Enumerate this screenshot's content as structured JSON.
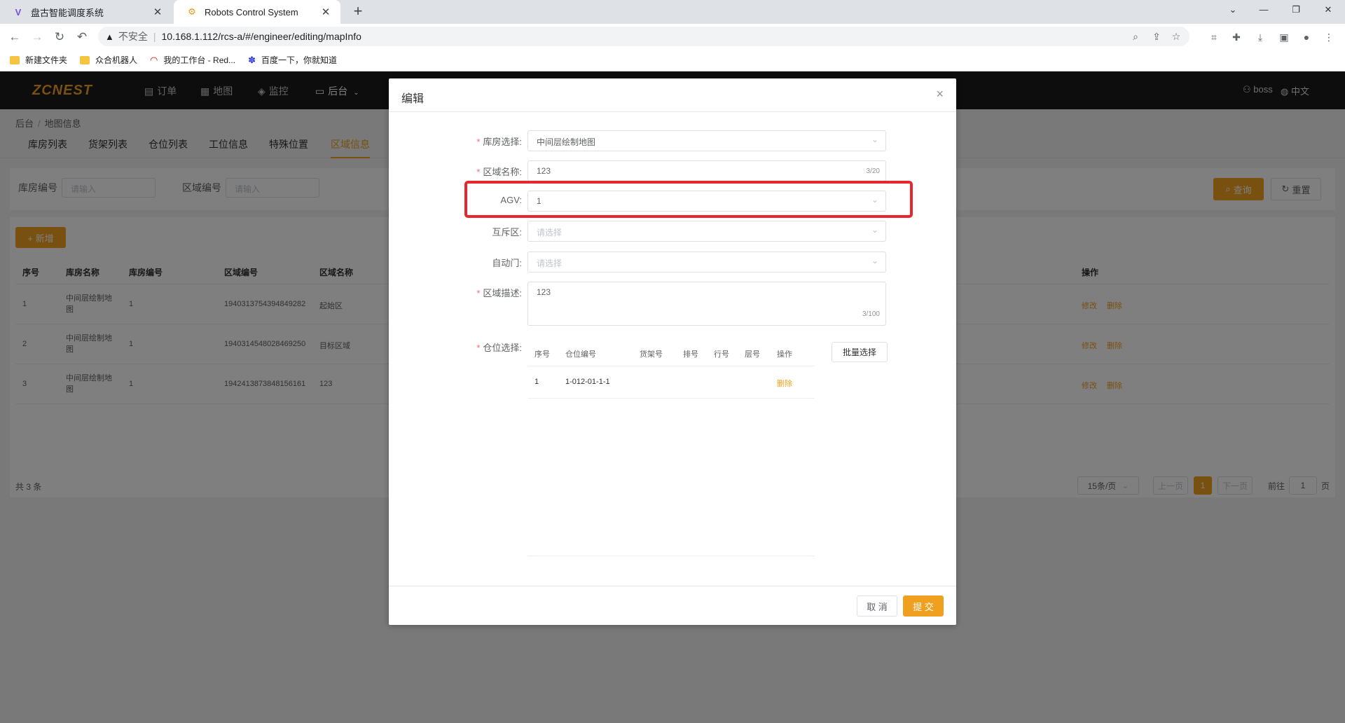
{
  "browser": {
    "tabs": [
      {
        "title": "盘古智能调度系统",
        "close": "✕"
      },
      {
        "title": "Robots Control System",
        "close": "✕"
      }
    ],
    "new_tab": "+",
    "insecure_label": "不安全",
    "url": "10.168.1.112/rcs-a/#/engineer/editing/mapInfo",
    "bookmarks": [
      "新建文件夹",
      "众合机器人",
      "我的工作台 - Red...",
      "百度一下，你就知道"
    ]
  },
  "app": {
    "logo": "ZCNEST",
    "nav": [
      "订单",
      "地图",
      "监控",
      "后台"
    ],
    "user": "boss",
    "lang": "中文",
    "breadcrumb": [
      "后台",
      "地图信息"
    ],
    "subtabs": [
      "库房列表",
      "货架列表",
      "仓位列表",
      "工位信息",
      "特殊位置",
      "区域信息"
    ],
    "active_subtab": "区域信息",
    "filter": {
      "warehouse_label": "库房编号",
      "warehouse_placeholder": "请输入",
      "area_label": "区域编号",
      "area_placeholder": "请输入",
      "search": "查询",
      "reset": "重置"
    },
    "add_button": "+ 新增",
    "table": {
      "headers": [
        "序号",
        "库房名称",
        "库房编号",
        "区域编号",
        "区域名称",
        "操作"
      ],
      "rows": [
        {
          "no": "1",
          "wh_name": "中间层绘制地图",
          "wh_no": "1",
          "area_no": "1940313754394849282",
          "area_name": "起始区"
        },
        {
          "no": "2",
          "wh_name": "中间层绘制地图",
          "wh_no": "1",
          "area_no": "1940314548028469250",
          "area_name": "目标区域"
        },
        {
          "no": "3",
          "wh_name": "中间层绘制地图",
          "wh_no": "1",
          "area_no": "1942413873848156161",
          "area_name": "123"
        }
      ],
      "edit": "修改",
      "delete": "删除"
    },
    "pagination": {
      "total": "共 3 条",
      "page_size": "15条/页",
      "prev": "上一页",
      "current": "1",
      "next": "下一页",
      "goto_label": "前往",
      "goto_value": "1",
      "page_suffix": "页"
    }
  },
  "dialog": {
    "title": "编辑",
    "close": "×",
    "fields": {
      "warehouse": {
        "label": "库房选择:",
        "value": "中间层绘制地图"
      },
      "area_name": {
        "label": "区域名称:",
        "value": "123",
        "count": "3/20"
      },
      "agv": {
        "label": "AGV:",
        "value": "1"
      },
      "mutex": {
        "label": "互斥区:",
        "placeholder": "请选择"
      },
      "auto_door": {
        "label": "自动门:",
        "placeholder": "请选择"
      },
      "desc": {
        "label": "区域描述:",
        "value": "123",
        "count": "3/100"
      },
      "slot": {
        "label": "仓位选择:"
      }
    },
    "slot_table": {
      "headers": [
        "序号",
        "仓位编号",
        "货架号",
        "排号",
        "行号",
        "层号",
        "操作"
      ],
      "rows": [
        {
          "no": "1",
          "code": "1-012-01-1-1",
          "action": "删除"
        }
      ]
    },
    "batch_select": "批量选择",
    "cancel": "取 消",
    "submit": "提 交",
    "highlight_color": "#e8262e"
  }
}
